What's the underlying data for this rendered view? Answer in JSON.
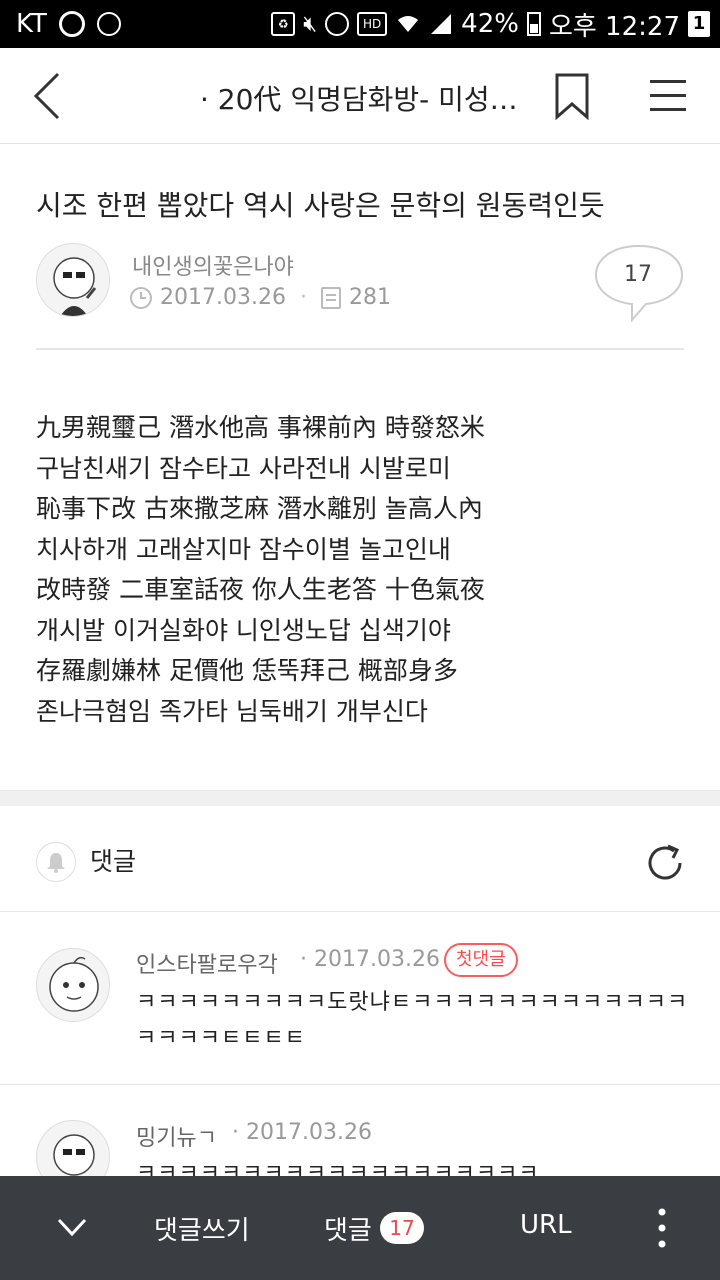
{
  "status_bar": {
    "carrier": "KT",
    "battery": "42%",
    "time": "오후 12:27",
    "notif_count": "1"
  },
  "nav": {
    "title": "· 20代 익명담화방- 미성…"
  },
  "post": {
    "title": "시조 한편 뽑았다 역시 사랑은 문학의 원동력인듯",
    "author": "내인생의꽃은나야",
    "date": "2017.03.26",
    "views": "281",
    "comment_count": "17",
    "body_lines": [
      "九男親璽己 潛水他高 事裸前內 時發怒米",
      "구남친새기 잠수타고 사라전내 시발로미",
      "恥事下改 古來撒芝麻 潛水離別 놀高人內",
      "치사하개 고래살지마 잠수이별 놀고인내",
      "改時發 二車室話夜 你人生老答 十色氣夜",
      "개시발 이거실화야 니인생노답 십색기야",
      "存羅劇嫌林 足價他 恁뚝拜己 概部身多",
      "존나극혐임 족가타 님둑배기 개부신다"
    ]
  },
  "comments": {
    "header_label": "댓글",
    "items": [
      {
        "author": "인스타팔로우각",
        "date": "· 2017.03.26",
        "badge": "첫댓글",
        "line1": "ㅋㅋㅋㅋㅋㅋㅋㅋㅋ도랏냐ㅌㅋㅋㅋㅋㅋㅋㅋㅋㅋㅋㅋㅋㅋ",
        "line2": "ㅋㅋㅋㅋㅌㅌㅌㅌ"
      },
      {
        "author": "밍기뉴ㄱ",
        "date": "· 2017.03.26",
        "line1": "ㅋㅋㅋㅋㅋㅋㅋㅋㅋㅋㅋㅋㅋㅋㅋㅋㅋㅋㅋ"
      }
    ]
  },
  "bottom_bar": {
    "write_label": "댓글쓰기",
    "comments_label": "댓글",
    "comments_count": "17",
    "url_label": "URL"
  },
  "colors": {
    "status_bar": "#000000",
    "bottom_bar": "#3a3d42",
    "badge_red": "#ff4a4a"
  }
}
